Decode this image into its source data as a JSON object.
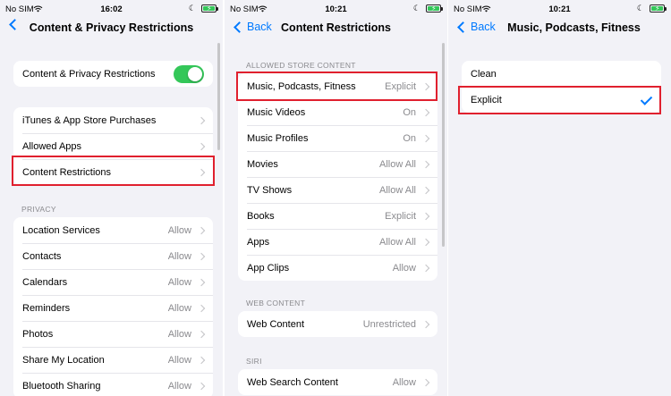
{
  "screen1": {
    "status": {
      "carrier": "No SIM",
      "time": "16:02"
    },
    "title": "Content & Privacy Restrictions",
    "toggle_row": {
      "label": "Content & Privacy Restrictions",
      "on": true
    },
    "menu": [
      {
        "label": "iTunes & App Store Purchases"
      },
      {
        "label": "Allowed Apps"
      },
      {
        "label": "Content Restrictions"
      }
    ],
    "privacy_header": "PRIVACY",
    "privacy": [
      {
        "label": "Location Services",
        "value": "Allow"
      },
      {
        "label": "Contacts",
        "value": "Allow"
      },
      {
        "label": "Calendars",
        "value": "Allow"
      },
      {
        "label": "Reminders",
        "value": "Allow"
      },
      {
        "label": "Photos",
        "value": "Allow"
      },
      {
        "label": "Share My Location",
        "value": "Allow"
      },
      {
        "label": "Bluetooth Sharing",
        "value": "Allow"
      }
    ]
  },
  "screen2": {
    "status": {
      "carrier": "No SIM",
      "time": "10:21"
    },
    "back": "Back",
    "title": "Content Restrictions",
    "store_header": "ALLOWED STORE CONTENT",
    "store": [
      {
        "label": "Music, Podcasts, Fitness",
        "value": "Explicit"
      },
      {
        "label": "Music Videos",
        "value": "On"
      },
      {
        "label": "Music Profiles",
        "value": "On"
      },
      {
        "label": "Movies",
        "value": "Allow All"
      },
      {
        "label": "TV Shows",
        "value": "Allow All"
      },
      {
        "label": "Books",
        "value": "Explicit"
      },
      {
        "label": "Apps",
        "value": "Allow All"
      },
      {
        "label": "App Clips",
        "value": "Allow"
      }
    ],
    "web_header": "WEB CONTENT",
    "web": {
      "label": "Web Content",
      "value": "Unrestricted"
    },
    "siri_header": "SIRI",
    "siri": {
      "label": "Web Search Content",
      "value": "Allow"
    }
  },
  "screen3": {
    "status": {
      "carrier": "No SIM",
      "time": "10:21"
    },
    "back": "Back",
    "title": "Music, Podcasts, Fitness",
    "options": [
      {
        "label": "Clean",
        "selected": false
      },
      {
        "label": "Explicit",
        "selected": true
      }
    ]
  },
  "colors": {
    "accent": "#007aff",
    "toggle_on": "#34c759",
    "highlight": "#e0202e",
    "background": "#f2f2f7"
  }
}
